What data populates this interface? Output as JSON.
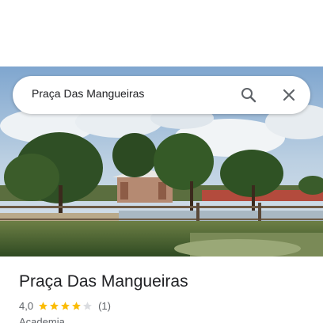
{
  "search": {
    "query": "Praça Das Mangueiras"
  },
  "place": {
    "title": "Praça Das Mangueiras",
    "rating": "4,0",
    "rating_value": 4,
    "rating_max": 5,
    "review_count": "(1)",
    "category": "Academia"
  },
  "colors": {
    "star_filled": "#fbbc04",
    "star_empty": "#dadce0",
    "text_primary": "#202124",
    "text_secondary": "#5f6368"
  },
  "icons": {
    "search": "search-icon",
    "close": "close-icon",
    "star": "star-icon"
  }
}
